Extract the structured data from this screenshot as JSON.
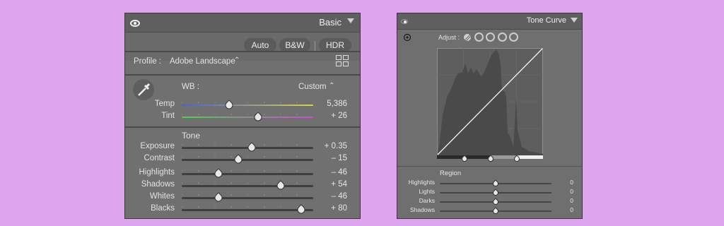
{
  "basic": {
    "title": "Basic",
    "buttons": [
      "Auto",
      "B&W",
      "HDR"
    ],
    "profile_label": "Profile :",
    "profile_value": "Adobe Landscape",
    "wb_label": "WB :",
    "wb_value": "Custom",
    "tone_heading": "Tone",
    "sliders": [
      {
        "label": "Temp",
        "value": "5,386",
        "position": 0.36
      },
      {
        "label": "Tint",
        "value": "+ 26",
        "position": 0.58
      },
      {
        "label": "Exposure",
        "value": "+ 0.35",
        "position": 0.53
      },
      {
        "label": "Contrast",
        "value": "– 15",
        "position": 0.43
      },
      {
        "label": "Highlights",
        "value": "– 46",
        "position": 0.28
      },
      {
        "label": "Shadows",
        "value": "+ 54",
        "position": 0.75
      },
      {
        "label": "Whites",
        "value": "– 46",
        "position": 0.28
      },
      {
        "label": "Blacks",
        "value": "+ 80",
        "position": 0.91
      }
    ]
  },
  "tone_curve": {
    "title": "Tone Curve",
    "adjust_label": "Adjust :",
    "channel_colors": [
      "#d8d8d8",
      "#e46a6a",
      "#5ac95a",
      "#6aa8f0"
    ],
    "region_label": "Region",
    "sliders": [
      {
        "label": "Highlights",
        "value": "0",
        "position": 0.5
      },
      {
        "label": "Lights",
        "value": "0",
        "position": 0.5
      },
      {
        "label": "Darks",
        "value": "0",
        "position": 0.5
      },
      {
        "label": "Shadows",
        "value": "0",
        "position": 0.5
      }
    ]
  }
}
